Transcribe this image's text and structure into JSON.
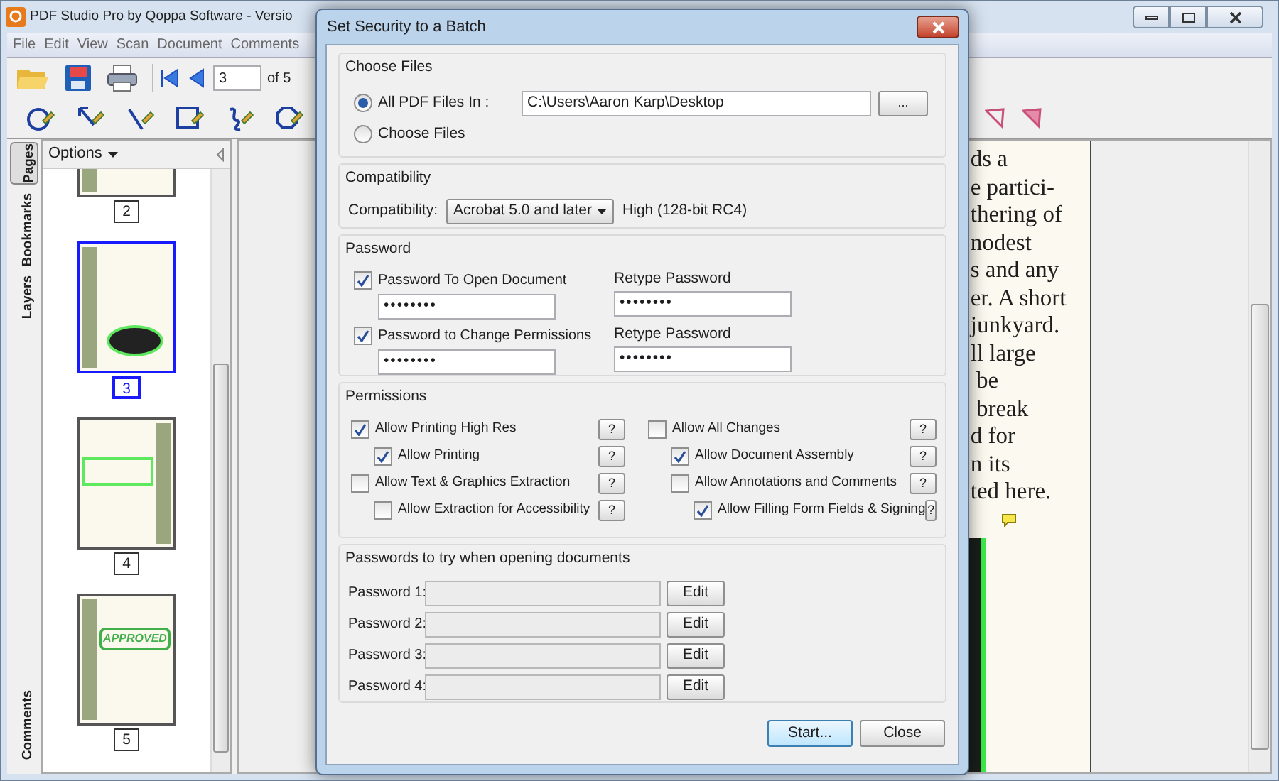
{
  "window": {
    "title": "PDF Studio Pro by Qoppa Software - Versio"
  },
  "menu": [
    "File",
    "Edit",
    "View",
    "Scan",
    "Document",
    "Comments"
  ],
  "toolbar": {
    "page_field": "3",
    "page_count": "of 5"
  },
  "side_tabs": [
    {
      "label": "Pages",
      "selected": true
    },
    {
      "label": "Bookmarks",
      "selected": false
    },
    {
      "label": "Layers",
      "selected": false
    },
    {
      "label": "Comments",
      "selected": false
    }
  ],
  "thumbnails": {
    "options": "Options",
    "pages": [
      {
        "label": "2",
        "selected": false,
        "kind": "plain"
      },
      {
        "label": "3",
        "selected": true,
        "kind": "photo"
      },
      {
        "label": "4",
        "selected": false,
        "kind": "boxed"
      },
      {
        "label": "5",
        "selected": false,
        "kind": "stamp",
        "stamp": "APPROVED"
      }
    ]
  },
  "document": {
    "lines": [
      "ds a",
      "e partici-",
      "thering of",
      "nodest",
      "s and any",
      "er. A short",
      "junkyard.",
      "ll large",
      " be",
      " break",
      "d for",
      "n its",
      "ted here."
    ]
  },
  "dialog": {
    "title": "Set Security to a Batch",
    "choose_files": {
      "heading": "Choose Files",
      "options": [
        {
          "label": "All PDF Files In :",
          "selected": true
        },
        {
          "label": "Choose Files",
          "selected": false
        }
      ],
      "folder": "C:\\Users\\Aaron Karp\\Desktop",
      "browse": "..."
    },
    "compatibility": {
      "heading": "Compatibility",
      "label": "Compatibility:",
      "value": "Acrobat 5.0 and later",
      "strength": "High (128-bit RC4)"
    },
    "password": {
      "heading": "Password",
      "rows": [
        {
          "label": "Password To Open Document",
          "checked": true,
          "value": "••••••••",
          "retype_label": "Retype Password",
          "retype_value": "••••••••"
        },
        {
          "label": "Password to Change Permissions",
          "checked": true,
          "value": "••••••••",
          "retype_label": "Retype Password",
          "retype_value": "••••••••"
        }
      ]
    },
    "permissions": {
      "heading": "Permissions",
      "columns": [
        [
          {
            "label": "Allow Printing High Res",
            "checked": true,
            "help": "?",
            "children": [
              {
                "label": "Allow Printing",
                "checked": true,
                "help": "?"
              }
            ]
          },
          {
            "label": "Allow Text & Graphics Extraction",
            "checked": false,
            "help": "?",
            "children": [
              {
                "label": "Allow Extraction for Accessibility",
                "checked": false,
                "help": "?"
              }
            ]
          }
        ],
        [
          {
            "label": "Allow All Changes",
            "checked": false,
            "help": "?",
            "children": [
              {
                "label": "Allow Document Assembly",
                "checked": true,
                "help": "?"
              },
              {
                "label": "Allow Annotations and Comments",
                "checked": false,
                "help": "?",
                "children": [
                  {
                    "label": "Allow Filling Form Fields & Signing",
                    "checked": true,
                    "help": "?"
                  }
                ]
              }
            ]
          }
        ]
      ]
    },
    "try_passwords": {
      "heading": "Passwords to try when opening documents",
      "rows": [
        {
          "label": "Password 1:",
          "button": "Edit"
        },
        {
          "label": "Password 2:",
          "button": "Edit"
        },
        {
          "label": "Password 3:",
          "button": "Edit"
        },
        {
          "label": "Password 4:",
          "button": "Edit"
        }
      ]
    },
    "buttons": [
      {
        "label": "Start...",
        "default": true
      },
      {
        "label": "Close",
        "default": false
      }
    ]
  }
}
